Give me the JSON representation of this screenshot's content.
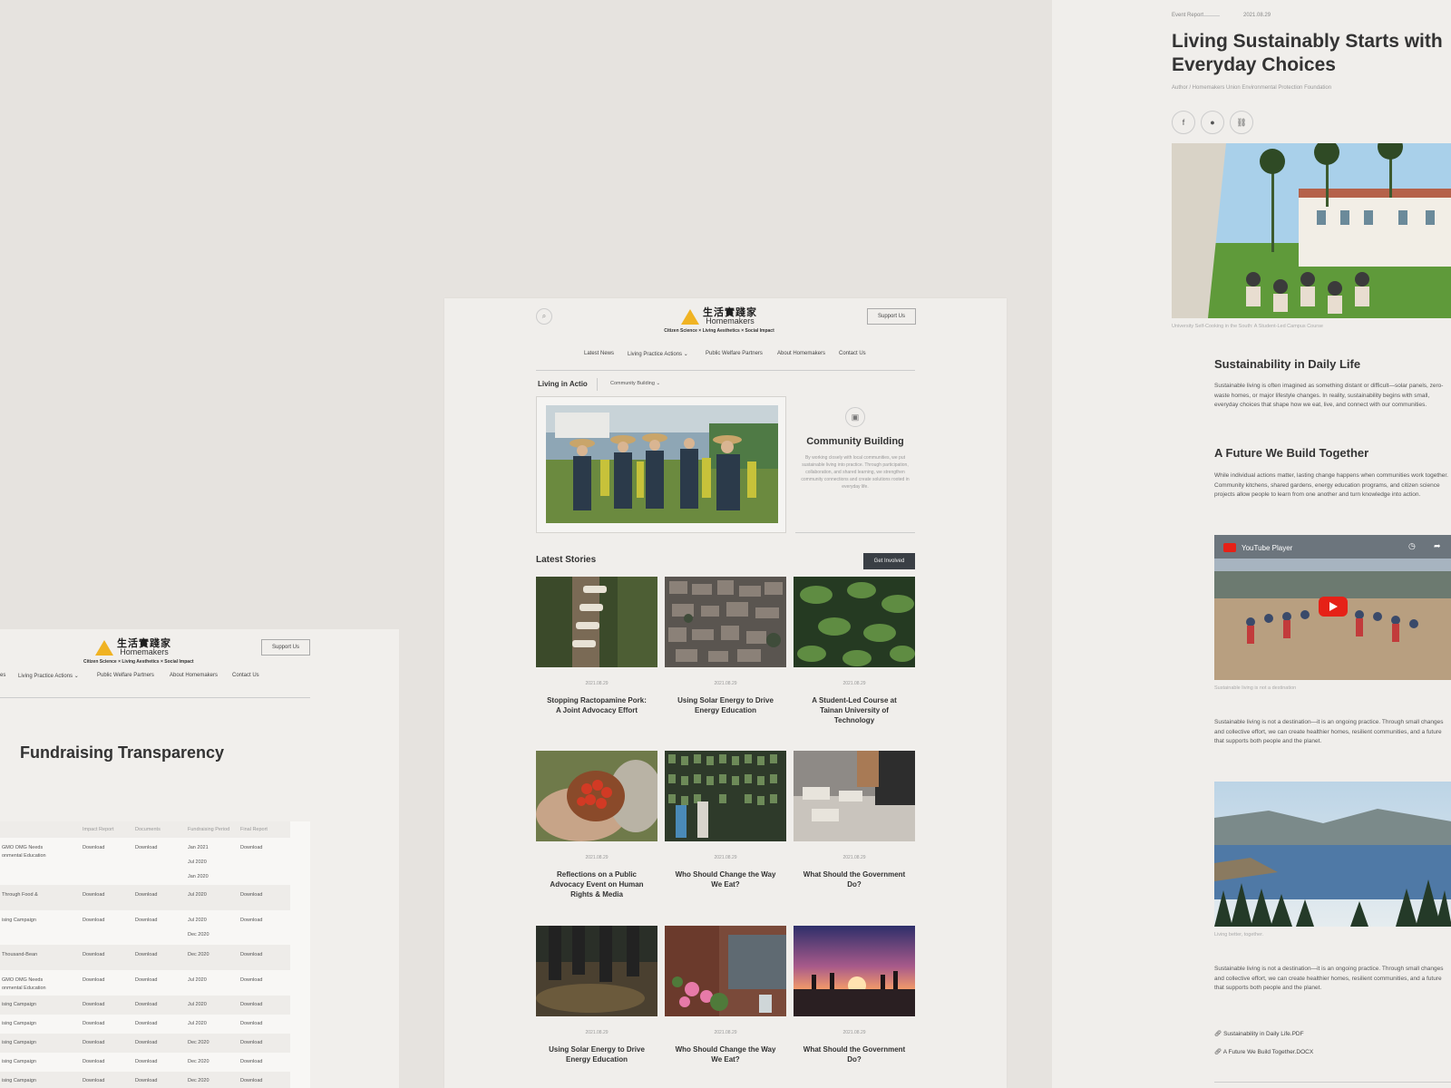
{
  "brand": {
    "name_cn": "生活實踐家",
    "name_en": "Homemakers",
    "tagline": "Citizen Science × Living Aesthetics × Social Impact",
    "support_label": "Support Us"
  },
  "nav": {
    "items": [
      "Latest News",
      "Living Practice Actions",
      "Public Welfare Partners",
      "About Homemakers",
      "Contact Us"
    ]
  },
  "left": {
    "nav": [
      "es",
      "Living Practice Actions",
      "Public Welfare Partners",
      "About Homemakers",
      "Contact Us"
    ],
    "title": "Fundraising Transparency",
    "table": {
      "headers": [
        "Impact Report",
        "Documents",
        "Fundraising Period",
        "Final Report"
      ],
      "rows": [
        {
          "name1": "GMO OMG Needs",
          "name2": "onmental Education",
          "impact": "Download",
          "docs": "Download",
          "periods": [
            "Jan 2021",
            "Jul 2020",
            "Jan 2020"
          ],
          "final": "Download"
        },
        {
          "name1": "Through Food &",
          "name2": "",
          "impact": "Download",
          "docs": "Download",
          "periods": [
            "Jul 2020"
          ],
          "final": "Download"
        },
        {
          "name1": "ising Campaign",
          "name2": "",
          "impact": "Download",
          "docs": "Download",
          "periods": [
            "Jul 2020",
            "Dec 2020"
          ],
          "final": "Download"
        },
        {
          "name1": "Thousand-Bean",
          "name2": "",
          "impact": "Download",
          "docs": "Download",
          "periods": [
            "Dec 2020"
          ],
          "final": "Download"
        },
        {
          "name1": "GMO OMG Needs",
          "name2": "onmental Education",
          "impact": "Download",
          "docs": "Download",
          "periods": [
            "Jul 2020"
          ],
          "final": "Download"
        },
        {
          "name1": "ising Campaign",
          "name2": "",
          "impact": "Download",
          "docs": "Download",
          "periods": [
            "Jul 2020"
          ],
          "final": "Download"
        },
        {
          "name1": "ising Campaign",
          "name2": "",
          "impact": "Download",
          "docs": "Download",
          "periods": [
            "Jul 2020"
          ],
          "final": "Download"
        },
        {
          "name1": "ising Campaign",
          "name2": "",
          "impact": "Download",
          "docs": "Download",
          "periods": [
            "Dec 2020"
          ],
          "final": "Download"
        },
        {
          "name1": "ising Campaign",
          "name2": "",
          "impact": "Download",
          "docs": "Download",
          "periods": [
            "Dec 2020"
          ],
          "final": "Download"
        },
        {
          "name1": "ising Campaign",
          "name2": "",
          "impact": "Download",
          "docs": "Download",
          "periods": [
            "Dec 2020"
          ],
          "final": "Download"
        }
      ]
    }
  },
  "center": {
    "crumb": "Living in Actio",
    "crumb_select": "Community Building",
    "feature": {
      "title": "Community Building",
      "desc": "By working closely with local communities, we put sustainable living into practice. Through participation, collaboration, and shared learning, we strengthen community connections and create solutions rooted in everyday life."
    },
    "latest_label": "Latest Stories",
    "get_involved": "Get Involved",
    "cards": [
      {
        "date": "2021.08.29",
        "title": "Stopping Ractopamine Pork: A Joint Advocacy Effort"
      },
      {
        "date": "2021.08.29",
        "title": "Using Solar Energy to Drive Energy Education"
      },
      {
        "date": "2021.08.29",
        "title": "A Student-Led Course at Tainan University of Technology"
      },
      {
        "date": "2021.08.29",
        "title": "Reflections on a Public Advocacy Event on Human Rights & Media"
      },
      {
        "date": "2021.08.29",
        "title": "Who Should Change the Way We Eat?"
      },
      {
        "date": "2021.08.29",
        "title": "What Should the Government Do?"
      },
      {
        "date": "2021.08.29",
        "title": "Using Solar Energy to Drive Energy Education"
      },
      {
        "date": "2021.08.29",
        "title": "Who Should Change the Way We Eat?"
      },
      {
        "date": "2021.08.29",
        "title": "What Should the Government Do?"
      }
    ]
  },
  "right": {
    "category": "Event Report",
    "date": "2021.08.29",
    "title": "Living Sustainably Starts with Everyday Choices",
    "author": "Author / Homemakers Union Environmental Protection Foundation",
    "hero_caption": "University Self-Cooking in the South: A Student-Led Campus Course",
    "h2_1": "Sustainability in Daily Life",
    "p1": "Sustainable living is often imagined as something distant or difficult—solar panels, zero-waste homes, or major lifestyle changes. In reality, sustainability begins with small, everyday choices that shape how we eat, live, and connect with our communities.",
    "h2_2": "A Future We Build Together",
    "p2": "While individual actions matter, lasting change happens when communities work together. Community kitchens, shared gardens, energy education programs, and citizen science projects allow people to learn from one another and turn knowledge into action.",
    "video_label": "YouTube Player",
    "video_caption": "Sustainable living is not a destination",
    "p3": "Sustainable living is not a destination—it is an ongoing practice. Through small changes and collective effort, we can create healthier homes, resilient communities, and a future that supports both people and the planet.",
    "lake_caption": "Living better, together.",
    "p4": "Sustainable living is not a destination—it is an ongoing practice. Through small changes and collective effort, we can create healthier homes, resilient communities, and a future that supports both people and the planet.",
    "files": [
      "Sustainability in Daily Life.PDF",
      "A Future We Build Together.DOCX"
    ]
  }
}
